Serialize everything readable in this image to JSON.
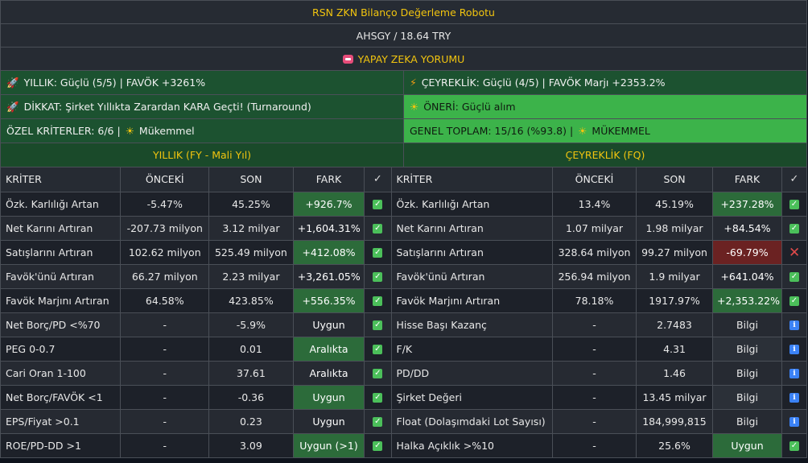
{
  "header": {
    "title": "RSN ZKN Bilanço Değerleme Robotu",
    "symbol_price": "AHSGY / 18.64 TRY",
    "ai_label": "YAPAY ZEKA YORUMU"
  },
  "summary": {
    "annual": "YILLIK: Güçlü (5/5) | FAVÖK +3261%",
    "quarterly": "ÇEYREKLİK: Güçlü (4/5) | FAVÖK Marjı +2353.2%",
    "attention": "DİKKAT: Şirket Yıllıkta Zarardan KARA Geçti! (Turnaround)",
    "recommendation": "ÖNERİ: Güçlü alım",
    "special": "ÖZEL KRİTERLER: 6/6 |",
    "special_rating": "Mükemmel",
    "total": "GENEL TOPLAM: 15/16 (%93.8) |",
    "total_rating": "MÜKEMMEL"
  },
  "annual_table": {
    "title": "YILLIK (FY - Mali Yıl)",
    "headers": [
      "KRİTER",
      "ÖNCEKİ",
      "SON",
      "FARK",
      "✓"
    ],
    "rows": [
      {
        "k": "Özk. Karlılığı Artan",
        "p": "-5.47%",
        "s": "45.25%",
        "f": "+926.7%",
        "st": "check",
        "fs": "pos"
      },
      {
        "k": "Net Karını Artıran",
        "p": "-207.73 milyon",
        "s": "3.12 milyar",
        "f": "+1,604.31%",
        "st": "check",
        "fs": "pos"
      },
      {
        "k": "Satışlarını Artıran",
        "p": "102.62 milyon",
        "s": "525.49 milyon",
        "f": "+412.08%",
        "st": "check",
        "fs": "pos"
      },
      {
        "k": "Favök'ünü Artıran",
        "p": "66.27 milyon",
        "s": "2.23 milyar",
        "f": "+3,261.05%",
        "st": "check",
        "fs": "pos"
      },
      {
        "k": "Favök Marjını Artıran",
        "p": "64.58%",
        "s": "423.85%",
        "f": "+556.35%",
        "st": "check",
        "fs": "pos"
      },
      {
        "k": "Net Borç/PD <%70",
        "p": "-",
        "s": "-5.9%",
        "f": "Uygun",
        "st": "check",
        "fs": "pos"
      },
      {
        "k": "PEG 0-0.7",
        "p": "-",
        "s": "0.01",
        "f": "Aralıkta",
        "st": "check",
        "fs": "pos"
      },
      {
        "k": "Cari Oran 1-100",
        "p": "-",
        "s": "37.61",
        "f": "Aralıkta",
        "st": "check",
        "fs": "pos"
      },
      {
        "k": "Net Borç/FAVÖK <1",
        "p": "-",
        "s": "-0.36",
        "f": "Uygun",
        "st": "check",
        "fs": "pos"
      },
      {
        "k": "EPS/Fiyat >0.1",
        "p": "-",
        "s": "0.23",
        "f": "Uygun",
        "st": "check",
        "fs": "pos"
      },
      {
        "k": "ROE/PD-DD >1",
        "p": "-",
        "s": "3.09",
        "f": "Uygun (>1)",
        "st": "check",
        "fs": "pos"
      }
    ]
  },
  "quarterly_table": {
    "title": "ÇEYREKLİK (FQ)",
    "headers": [
      "KRİTER",
      "ÖNCEKİ",
      "SON",
      "FARK",
      "✓"
    ],
    "rows": [
      {
        "k": "Özk. Karlılığı Artan",
        "p": "13.4%",
        "s": "45.19%",
        "f": "+237.28%",
        "st": "check",
        "fs": "pos"
      },
      {
        "k": "Net Karını Artıran",
        "p": "1.07 milyar",
        "s": "1.98 milyar",
        "f": "+84.54%",
        "st": "check",
        "fs": "pos"
      },
      {
        "k": "Satışlarını Artıran",
        "p": "328.64 milyon",
        "s": "99.27 milyon",
        "f": "-69.79%",
        "st": "cross",
        "fs": "neg"
      },
      {
        "k": "Favök'ünü Artıran",
        "p": "256.94 milyon",
        "s": "1.9 milyar",
        "f": "+641.04%",
        "st": "check",
        "fs": "pos"
      },
      {
        "k": "Favök Marjını Artıran",
        "p": "78.18%",
        "s": "1917.97%",
        "f": "+2,353.22%",
        "st": "check",
        "fs": "pos"
      },
      {
        "k": "Hisse Başı Kazanç",
        "p": "-",
        "s": "2.7483",
        "f": "Bilgi",
        "st": "info",
        "fs": "bilgi"
      },
      {
        "k": "F/K",
        "p": "-",
        "s": "4.31",
        "f": "Bilgi",
        "st": "info",
        "fs": "bilgi"
      },
      {
        "k": "PD/DD",
        "p": "-",
        "s": "1.46",
        "f": "Bilgi",
        "st": "info",
        "fs": "bilgi"
      },
      {
        "k": "Şirket Değeri",
        "p": "-",
        "s": "13.45 milyar",
        "f": "Bilgi",
        "st": "info",
        "fs": "bilgi"
      },
      {
        "k": "Float (Dolaşımdaki Lot Sayısı)",
        "p": "-",
        "s": "184,999,815",
        "f": "Bilgi",
        "st": "info",
        "fs": "bilgi"
      },
      {
        "k": "Halka Açıklık >%10",
        "p": "-",
        "s": "25.6%",
        "f": "Uygun",
        "st": "check",
        "fs": "pos"
      }
    ]
  },
  "colors": {
    "accent": "#f1c40f",
    "positive": "#2c6b3a",
    "negative": "#6b2222",
    "info": "#3b82f6"
  }
}
